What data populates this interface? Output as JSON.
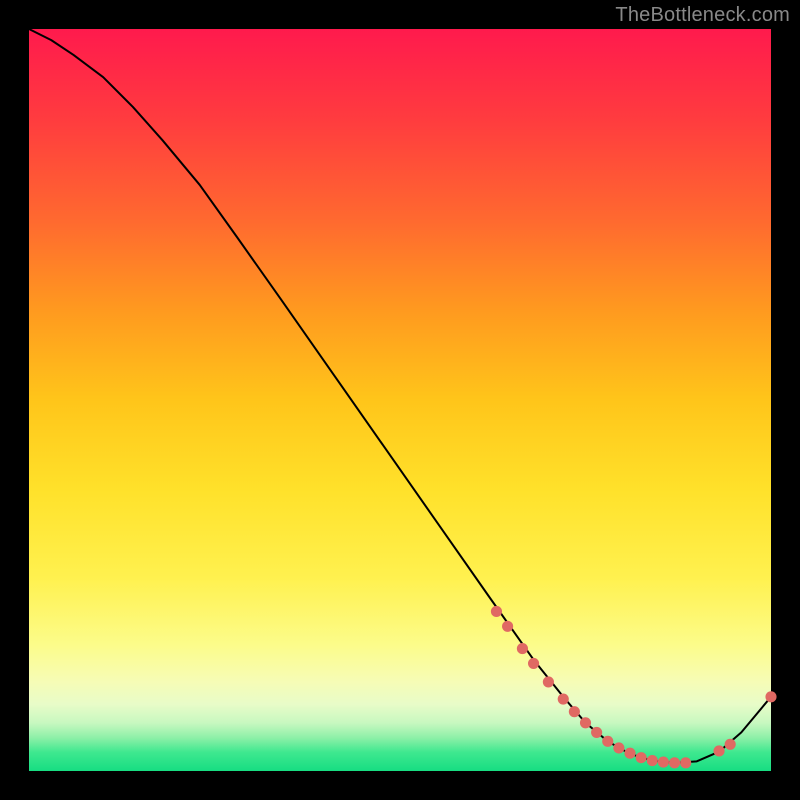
{
  "watermark": "TheBottleneck.com",
  "chart_data": {
    "type": "line",
    "title": "",
    "xlabel": "",
    "ylabel": "",
    "xlim": [
      0,
      100
    ],
    "ylim": [
      0,
      100
    ],
    "grid": false,
    "legend": false,
    "series": [
      {
        "name": "bottleneck-curve",
        "color": "#000000",
        "x": [
          0,
          3,
          6,
          10,
          14,
          18,
          23,
          28,
          34,
          41,
          48,
          55,
          62,
          68,
          72,
          75,
          78,
          81,
          84,
          87,
          90,
          93,
          96,
          100
        ],
        "y": [
          100,
          98.5,
          96.5,
          93.5,
          89.5,
          85,
          79,
          72,
          63.5,
          53.5,
          43.5,
          33.5,
          23.5,
          15,
          10,
          6.5,
          4,
          2.3,
          1.4,
          1.1,
          1.3,
          2.6,
          5.2,
          10
        ]
      },
      {
        "name": "marker-points",
        "type": "scatter",
        "color": "#e06963",
        "x": [
          63,
          64.5,
          66.5,
          68,
          70,
          72,
          73.5,
          75,
          76.5,
          78,
          79.5,
          81,
          82.5,
          84,
          85.5,
          87,
          88.5,
          93,
          94.5,
          100
        ],
        "y": [
          21.5,
          19.5,
          16.5,
          14.5,
          12,
          9.7,
          8,
          6.5,
          5.2,
          4,
          3.1,
          2.4,
          1.8,
          1.4,
          1.2,
          1.1,
          1.1,
          2.7,
          3.6,
          10
        ]
      }
    ],
    "colors": {
      "curve": "#000000",
      "marker": "#e06963",
      "gradient_top": "#ff1a4d",
      "gradient_mid": "#fff14f",
      "gradient_bottom": "#17dd82",
      "frame": "#000000"
    }
  }
}
